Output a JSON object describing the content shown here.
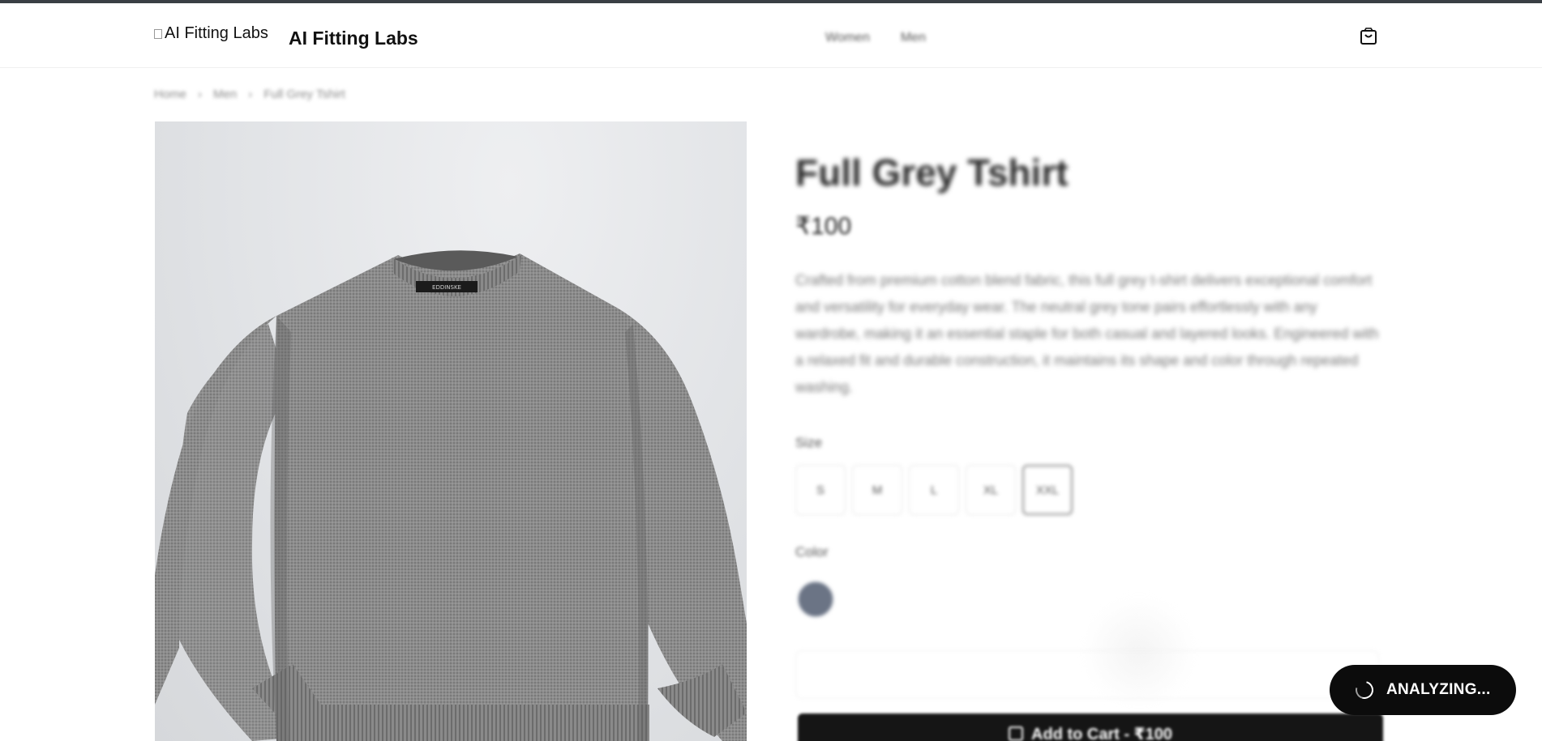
{
  "header": {
    "logo_alt": "AI Fitting Labs",
    "brand": "AI Fitting Labs",
    "nav": [
      "Women",
      "Men"
    ],
    "cart_icon": "shopping-bag-icon"
  },
  "breadcrumb": [
    "Home",
    "›",
    "Men",
    "›",
    "Full Grey Tshirt"
  ],
  "product": {
    "image_alt": "Grey crew-neck knit sweater",
    "collar_tag": "EDDINSKE",
    "title": "Full Grey Tshirt",
    "price": "₹100",
    "description": "Crafted from premium cotton blend fabric, this full grey t-shirt delivers exceptional comfort and versatility for everyday wear. The neutral grey tone pairs effortlessly with any wardrobe, making it an essential staple for both casual and layered looks. Engineered with a relaxed fit and durable construction, it maintains its shape and color through repeated washing.",
    "size_label": "Size",
    "sizes": [
      "S",
      "M",
      "L",
      "XL",
      "XXL"
    ],
    "selected_size": "XXL",
    "color_label": "Color",
    "color_swatch": "#6b7485"
  },
  "actions": {
    "add_to_cart": "Add to Cart - ₹100"
  },
  "overlay": {
    "status": "ANALYZING..."
  }
}
